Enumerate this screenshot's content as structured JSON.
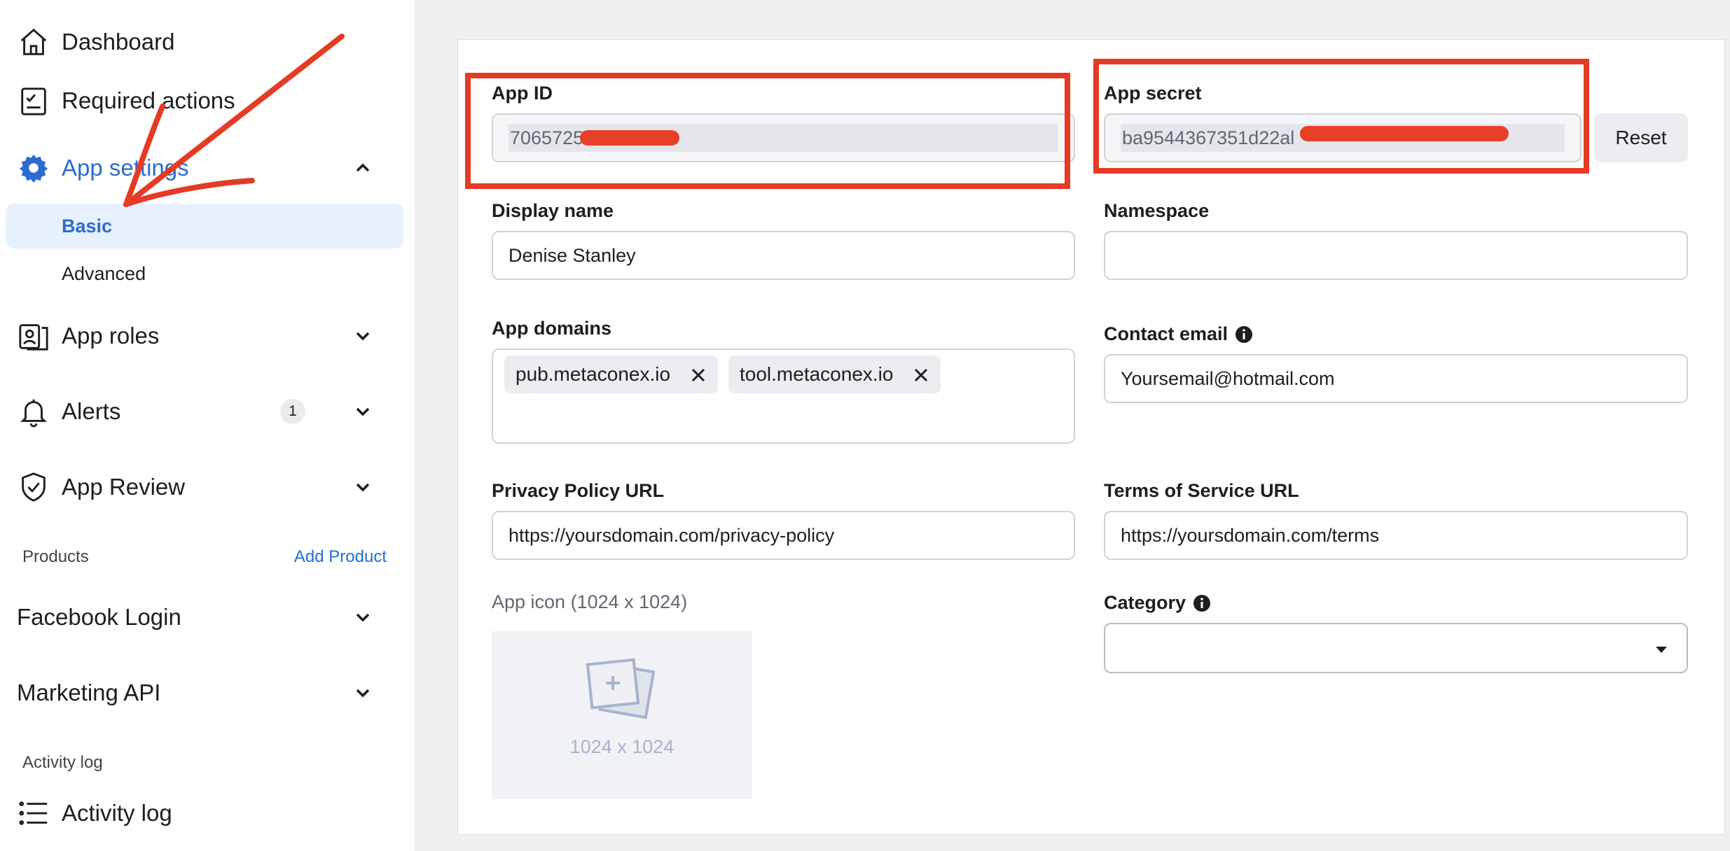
{
  "sidebar": {
    "dashboard": "Dashboard",
    "required_actions": "Required actions",
    "app_settings": "App settings",
    "basic": "Basic",
    "advanced": "Advanced",
    "app_roles": "App roles",
    "alerts": "Alerts",
    "alerts_count": "1",
    "app_review": "App Review",
    "products_label": "Products",
    "add_product": "Add Product",
    "facebook_login": "Facebook Login",
    "marketing_api": "Marketing API",
    "activity_log_section": "Activity log",
    "activity_log": "Activity log"
  },
  "form": {
    "app_id_label": "App ID",
    "app_id_value": "7065725",
    "app_secret_label": "App secret",
    "app_secret_value": "ba9544367351d22al",
    "reset_label": "Reset",
    "display_name_label": "Display name",
    "display_name_value": "Denise Stanley",
    "namespace_label": "Namespace",
    "namespace_value": "",
    "app_domains_label": "App domains",
    "domains": [
      "pub.metaconex.io",
      "tool.metaconex.io"
    ],
    "contact_email_label": "Contact email",
    "contact_email_value": "Yoursemail@hotmail.com",
    "privacy_label": "Privacy Policy URL",
    "privacy_value": "https://yoursdomain.com/privacy-policy",
    "terms_label": "Terms of Service URL",
    "terms_value": "https://yoursdomain.com/terms",
    "app_icon_label": "App icon (1024 x 1024)",
    "app_icon_size": "1024 x 1024",
    "category_label": "Category",
    "category_value": ""
  },
  "colors": {
    "accent": "#1877f2",
    "annotation_red": "#e43b25"
  },
  "icons": [
    "home-icon",
    "checklist-icon",
    "gear-icon",
    "badge-icon",
    "bell-icon",
    "shield-check-icon",
    "list-icon",
    "chevron-up-icon",
    "chevron-down-icon",
    "info-icon",
    "close-icon",
    "image-add-icon",
    "caret-down-icon"
  ]
}
